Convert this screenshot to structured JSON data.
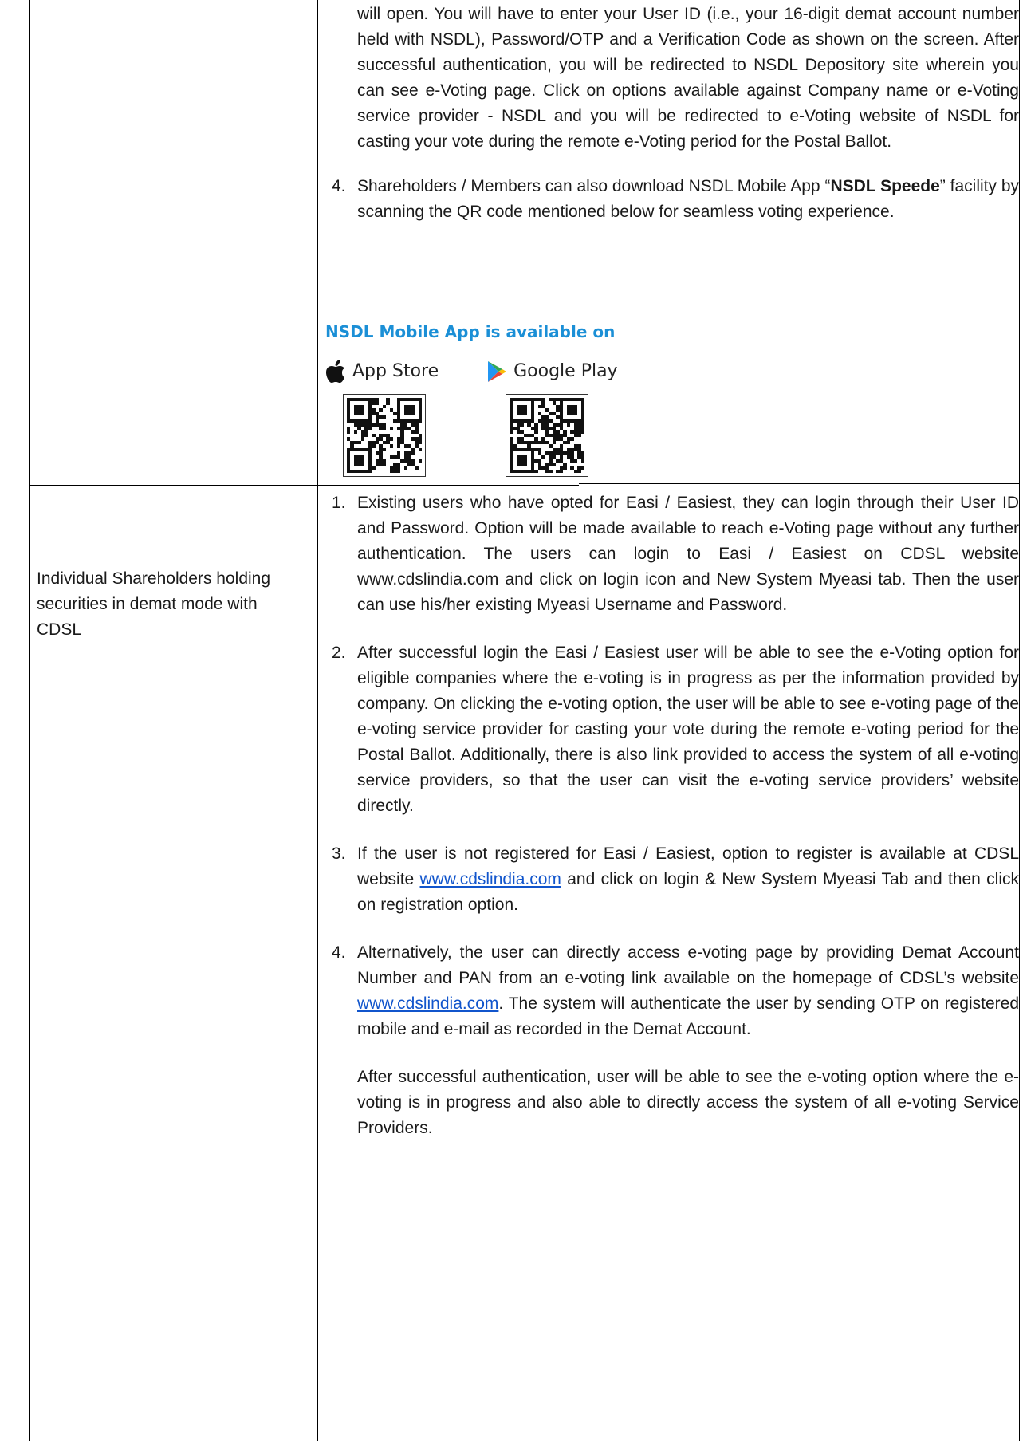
{
  "top_block": {
    "para_cont": "will open. You will have to enter your User ID (i.e., your 16-digit demat account number held with NSDL), Password/OTP and a Verification Code as shown on the screen. After successful authentication, you will be redirected to NSDL Depository site wherein you can see e-Voting page. Click on options available against Company name or e-Voting service provider - NSDL and you will be redirected to e-Voting website of NSDL for casting your vote during the remote e-Voting period for the Postal Ballot.",
    "item4_num": "4.",
    "item4_pre": "Shareholders / Members can also download NSDL Mobile App “",
    "item4_bold": "NSDL Speede",
    "item4_post": "” facility by scanning the QR code mentioned below for seamless voting experience."
  },
  "app_banner": {
    "title": "NSDL Mobile App is available on",
    "app_store": "App Store",
    "google_play": "Google Play"
  },
  "cdsl": {
    "left_label": "Individual Shareholders holding securities in demat mode with CDSL",
    "item1_num": "1.",
    "item1": "Existing users who have opted for Easi / Easiest, they can login through their User ID and Password. Option will be made available to reach e-Voting page without any further authentication. The users can login to Easi / Easiest on CDSL website www.cdslindia.com and click on login icon and New System Myeasi tab. Then the user can use his/her existing Myeasi Username and Password.",
    "item2_num": "2.",
    "item2": "After successful login the Easi / Easiest user will be able to see the e-Voting option for eligible companies where the e-voting is in progress as per the information provided by company. On clicking the e-voting option, the user will be able to see e-voting page of the e-voting service provider for casting your vote during the remote e-voting period for the Postal Ballot. Additionally, there is also link provided to access the system of all e-voting service providers, so that the user can visit the e-voting service providers’ website directly.",
    "item3_num": "3.",
    "item3_pre": "If the user is not registered for Easi / Easiest, option to register is available at CDSL website ",
    "item3_link": "www.cdslindia.com",
    "item3_post": " and click on login & New System Myeasi Tab and then click on registration option.",
    "item4_num": "4.",
    "item4_pre": "Alternatively, the user can directly access e-voting page by providing Demat Account Number and PAN from an e-voting link available on the homepage of CDSL’s website ",
    "item4_link": "www.cdslindia.com",
    "item4_post": ". The system will authenticate the user by sending OTP on registered mobile and e-mail as recorded in the Demat Account.",
    "item4_after": "After successful authentication, user will be able to see the e-voting option where the e-voting is in progress and also able to directly access the system of all e-voting Service Providers."
  }
}
